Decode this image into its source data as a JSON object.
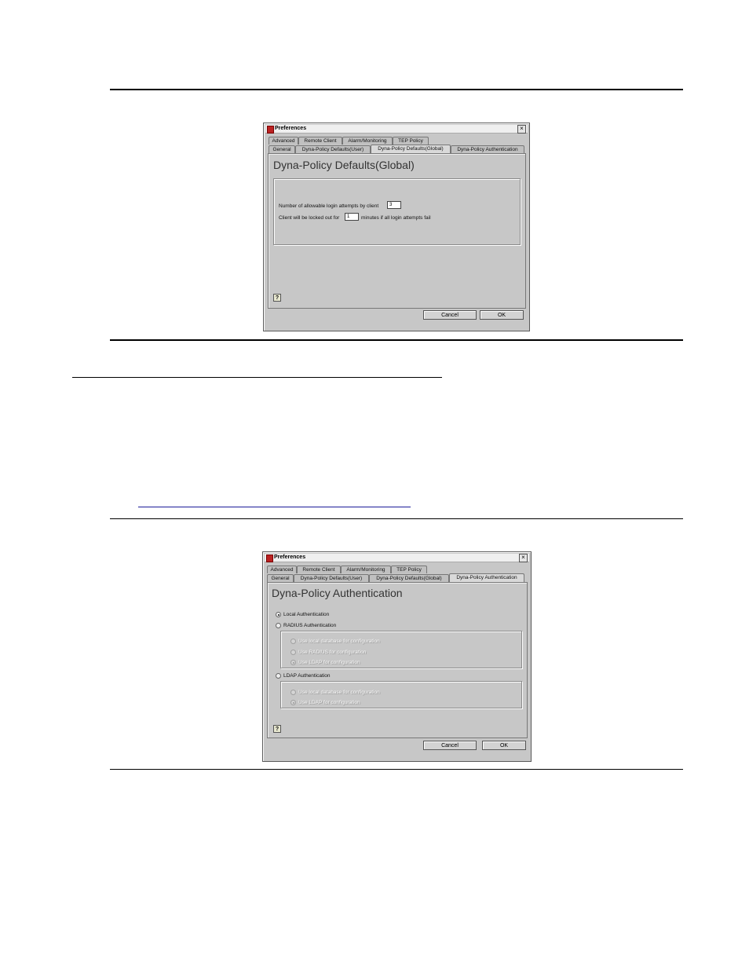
{
  "window1": {
    "title": "Preferences",
    "close_glyph": "×",
    "tabs_row1": [
      "Advanced",
      "Remote Client",
      "Alarm/Monitoring",
      "TEP Policy"
    ],
    "tabs_row2": [
      "General",
      "Dyna-Policy Defaults(User)",
      "Dyna-Policy Defaults(Global)",
      "Dyna-Policy Authentication"
    ],
    "active_tab": "Dyna-Policy Defaults(Global)",
    "panel_title": "Dyna-Policy Defaults(Global)",
    "login_attempts_label": "Number of allowable login attempts by client",
    "login_attempts_value": "3",
    "lockout_prefix": "Client will be locked out for",
    "lockout_value": "1",
    "lockout_suffix": "minutes if all login attempts fail",
    "help_glyph": "?",
    "cancel_label": "Cancel",
    "ok_label": "OK"
  },
  "window2": {
    "title": "Preferences",
    "close_glyph": "×",
    "tabs_row1": [
      "Advanced",
      "Remote Client",
      "Alarm/Monitoring",
      "TEP Policy"
    ],
    "tabs_row2": [
      "General",
      "Dyna-Policy Defaults(User)",
      "Dyna-Policy Defaults(Global)",
      "Dyna-Policy Authentication"
    ],
    "active_tab": "Dyna-Policy Authentication",
    "panel_title": "Dyna-Policy Authentication",
    "local_auth": "Local Authentication",
    "radius_auth": "RADIUS Authentication",
    "radius_opts": [
      "Use local database for configuration",
      "Use RADIUS for configuration",
      "Use LDAP for configuration"
    ],
    "ldap_auth": "LDAP Authentication",
    "ldap_opts": [
      "Use local database for configuration",
      "Use LDAP for configuration"
    ],
    "help_glyph": "?",
    "cancel_label": "Cancel",
    "ok_label": "OK"
  }
}
